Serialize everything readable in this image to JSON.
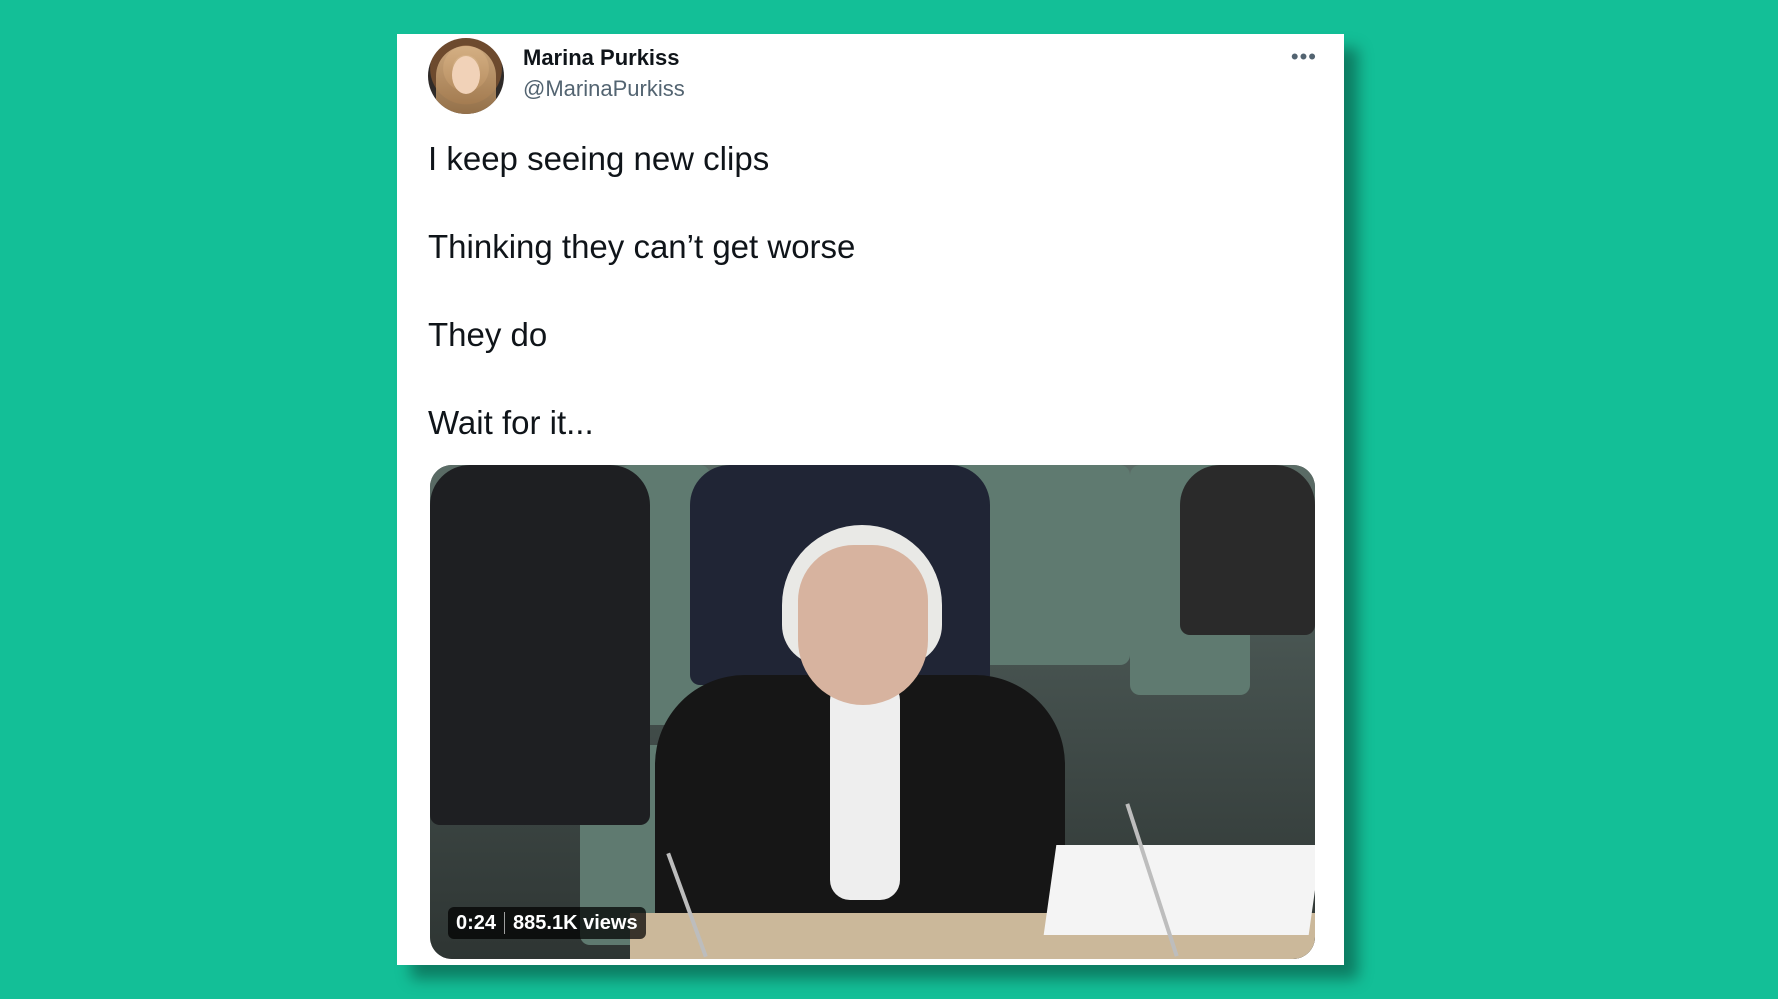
{
  "tweet": {
    "author_name": "Marina Purkiss",
    "author_handle": "@MarinaPurkiss",
    "more_icon": "•••",
    "lines": [
      "I keep seeing new clips",
      "Thinking they can’t get worse",
      "They do",
      "Wait for it..."
    ],
    "media": {
      "duration": "0:24",
      "views": "885.1K views"
    }
  },
  "colors": {
    "background": "#13bf97",
    "card": "#ffffff",
    "text": "#0f1419",
    "muted": "#536471"
  }
}
